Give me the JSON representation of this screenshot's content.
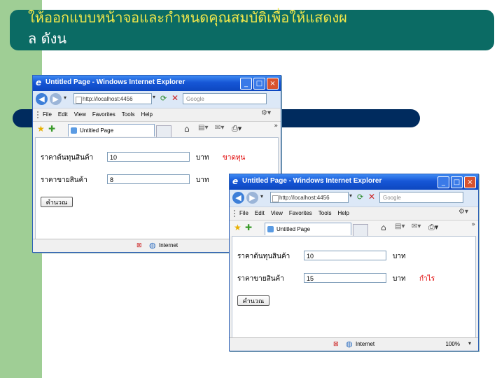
{
  "slide": {
    "title_line1": "ให้ออกแบบหน้าจอและกำหนดคุณสมบัติเพื่อให้แสดงผ",
    "title_line2": "ล ดังน"
  },
  "colors": {
    "left_strip": "#9fce95",
    "title_bar": "#0b6b64",
    "title_text": "#f2e84a",
    "navy_bar": "#002b5e",
    "result_text": "#e00000"
  },
  "windows": [
    {
      "title": "Untitled Page - Windows Internet Explorer",
      "address": "http://localhost:4456",
      "search_placeholder": "Google",
      "menu": [
        "File",
        "Edit",
        "View",
        "Favorites",
        "Tools",
        "Help"
      ],
      "tab_label": "Untitled Page",
      "form": {
        "cost_label": "ราคาต้นทุนสินค้า",
        "cost_value": "10",
        "sale_label": "ราคาขายสินค้า",
        "sale_value": "8",
        "unit": "บาท",
        "result": "ขาดทุน",
        "button": "คำนวณ"
      },
      "status": {
        "zone": "Internet",
        "zoom": ""
      }
    },
    {
      "title": "Untitled Page - Windows Internet Explorer",
      "address": "http://localhost:4456",
      "search_placeholder": "Google",
      "menu": [
        "File",
        "Edit",
        "View",
        "Favorites",
        "Tools",
        "Help"
      ],
      "tab_label": "Untitled Page",
      "form": {
        "cost_label": "ราคาต้นทุนสินค้า",
        "cost_value": "10",
        "sale_label": "ราคาขายสินค้า",
        "sale_value": "15",
        "unit": "บาท",
        "result": "กำไร",
        "button": "คำนวณ"
      },
      "status": {
        "zone": "Internet",
        "zoom": "100%"
      }
    }
  ],
  "icons": [
    "ie-logo-icon",
    "minimize-icon",
    "maximize-icon",
    "close-icon",
    "back-icon",
    "forward-icon",
    "page-icon",
    "refresh-icon",
    "stop-icon",
    "search-icon",
    "star-icon",
    "add-favorite-icon",
    "home-icon",
    "feeds-icon",
    "mail-icon",
    "print-icon",
    "globe-icon",
    "blocked-icon"
  ]
}
